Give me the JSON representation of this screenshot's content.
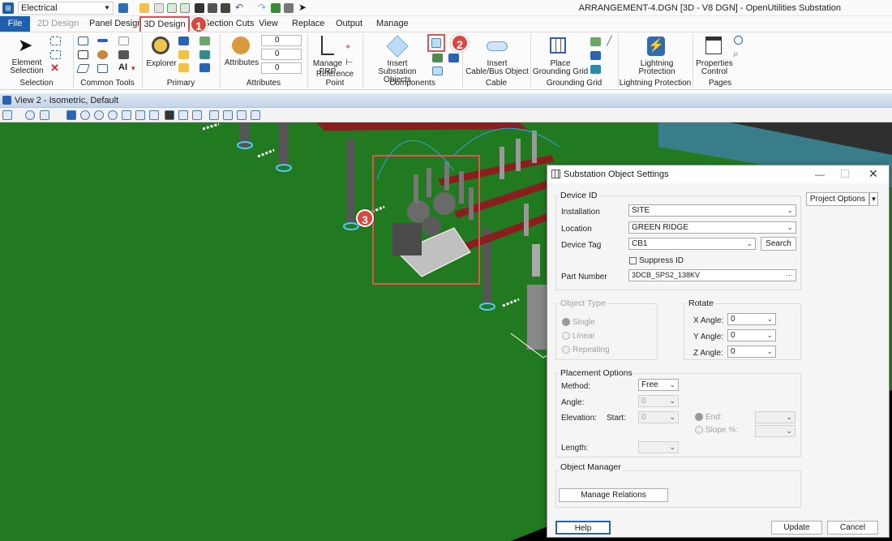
{
  "titlebar": {
    "workflow": "Electrical",
    "title": "ARRANGEMENT-4.DGN [3D - V8 DGN] - OpenUtilities Substation"
  },
  "tabs": [
    "File",
    "2D Design",
    "Panel Design",
    "3D Design",
    "Section Cuts",
    "View",
    "Replace",
    "Output",
    "Manage"
  ],
  "ribbon": {
    "groups": [
      "Selection",
      "Common Tools",
      "Primary",
      "Attributes",
      "Reference Point",
      "Components",
      "Cable",
      "Grounding Grid",
      "Lightning Protection",
      "Pages"
    ],
    "element_selection": "Element Selection",
    "element_selection_line1": "Element",
    "element_selection_line2": "Selection",
    "explorer": "Explorer",
    "attributes": "Attributes",
    "attr_values": [
      "0",
      "0",
      "0"
    ],
    "manage_prp_line1": "Manage",
    "manage_prp_line2": "PRP",
    "insert_sub_line1": "Insert",
    "insert_sub_line2": "Substation Objects",
    "insert_cable_line1": "Insert",
    "insert_cable_line2": "Cable/Bus Object",
    "place_grid_line1": "Place",
    "place_grid_line2": "Grounding Grid",
    "lightning_line1": "Lightning",
    "lightning_line2": "Protection",
    "properties_line1": "Properties",
    "properties_line2": "Control"
  },
  "view": {
    "title": "View 2 - Isometric, Default"
  },
  "callouts": [
    "1",
    "2",
    "3"
  ],
  "dialog": {
    "title": "Substation Object Settings",
    "project_options": "Project Options",
    "device_id": {
      "legend": "Device ID",
      "installation_label": "Installation",
      "installation": "SITE",
      "location_label": "Location",
      "location": "GREEN RIDGE",
      "device_tag_label": "Device Tag",
      "device_tag": "CB1",
      "search": "Search",
      "suppress_id": "Suppress ID",
      "part_number_label": "Part Number",
      "part_number": "3DCB_SPS2_138KV",
      "ellipsis": "···"
    },
    "object_type": {
      "legend": "Object Type",
      "single": "Single",
      "linear": "Linear",
      "repeating": "Repeating"
    },
    "rotate": {
      "legend": "Rotate",
      "x_label": "X Angle:",
      "x": "0",
      "y_label": "Y Angle:",
      "y": "0",
      "z_label": "Z Angle:",
      "z": "0"
    },
    "placement": {
      "legend": "Placement Options",
      "method_label": "Method:",
      "method": "Free",
      "angle_label": "Angle:",
      "angle": "0",
      "elevation_label": "Elevation:",
      "start_label": "Start:",
      "start": "0",
      "end_label": "End:",
      "slope_label": "Slope %:",
      "length_label": "Length:"
    },
    "object_manager": {
      "legend": "Object Manager",
      "manage_relations": "Manage Relations"
    },
    "buttons": {
      "help": "Help",
      "update": "Update",
      "cancel": "Cancel"
    }
  },
  "colors": {
    "accent": "#1f5fae",
    "callout": "#d9473f",
    "ground": "#217a1f",
    "crossbar": "#8a1e1e"
  }
}
